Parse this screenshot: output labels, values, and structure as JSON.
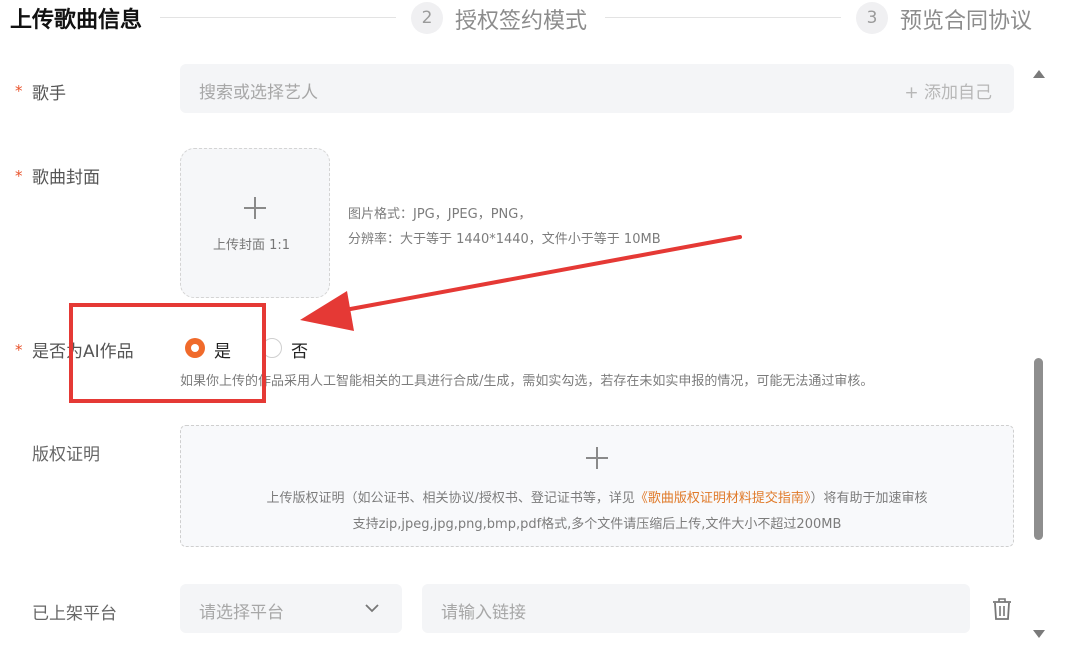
{
  "stepper": {
    "step1_title": "上传歌曲信息",
    "step2_number": "2",
    "step2_label": "授权签约模式",
    "step3_number": "3",
    "step3_label": "预览合同协议"
  },
  "form": {
    "required_mark": "*",
    "singer": {
      "label": "歌手",
      "placeholder": "搜索或选择艺人",
      "add_self": "+ 添加自己"
    },
    "cover": {
      "label": "歌曲封面",
      "upload_label": "上传封面 1:1",
      "hint_line1": "图片格式：JPG，JPEG，PNG，",
      "hint_line2": "分辨率：大于等于 1440*1440，文件小于等于 10MB"
    },
    "ai_work": {
      "label": "是否为AI作品",
      "option_yes": "是",
      "option_no": "否",
      "selected": "是",
      "hint": "如果你上传的作品采用人工智能相关的工具进行合成/生成，需如实勾选，若存在未如实申报的情况，可能无法通过审核。"
    },
    "copyright": {
      "label": "版权证明",
      "line1_prefix": "上传版权证明（如公证书、相关协议/授权书、登记证书等，详见",
      "line1_link": "《歌曲版权证明材料提交指南》",
      "line1_suffix": "）将有助于加速审核",
      "line2": "支持zip,jpeg,jpg,png,bmp,pdf格式,多个文件请压缩后上传,文件大小不超过200MB"
    },
    "platform": {
      "label": "已上架平台",
      "select_placeholder": "请选择平台",
      "link_placeholder": "请输入链接"
    }
  },
  "colors": {
    "accent": "#f06a2b",
    "required": "#e8542d",
    "annotation_red": "#e53935",
    "link": "#e07a2a"
  },
  "icons": [
    "plus-icon",
    "chevron-down-icon",
    "trash-icon",
    "scroll-up-icon",
    "scroll-down-icon"
  ]
}
